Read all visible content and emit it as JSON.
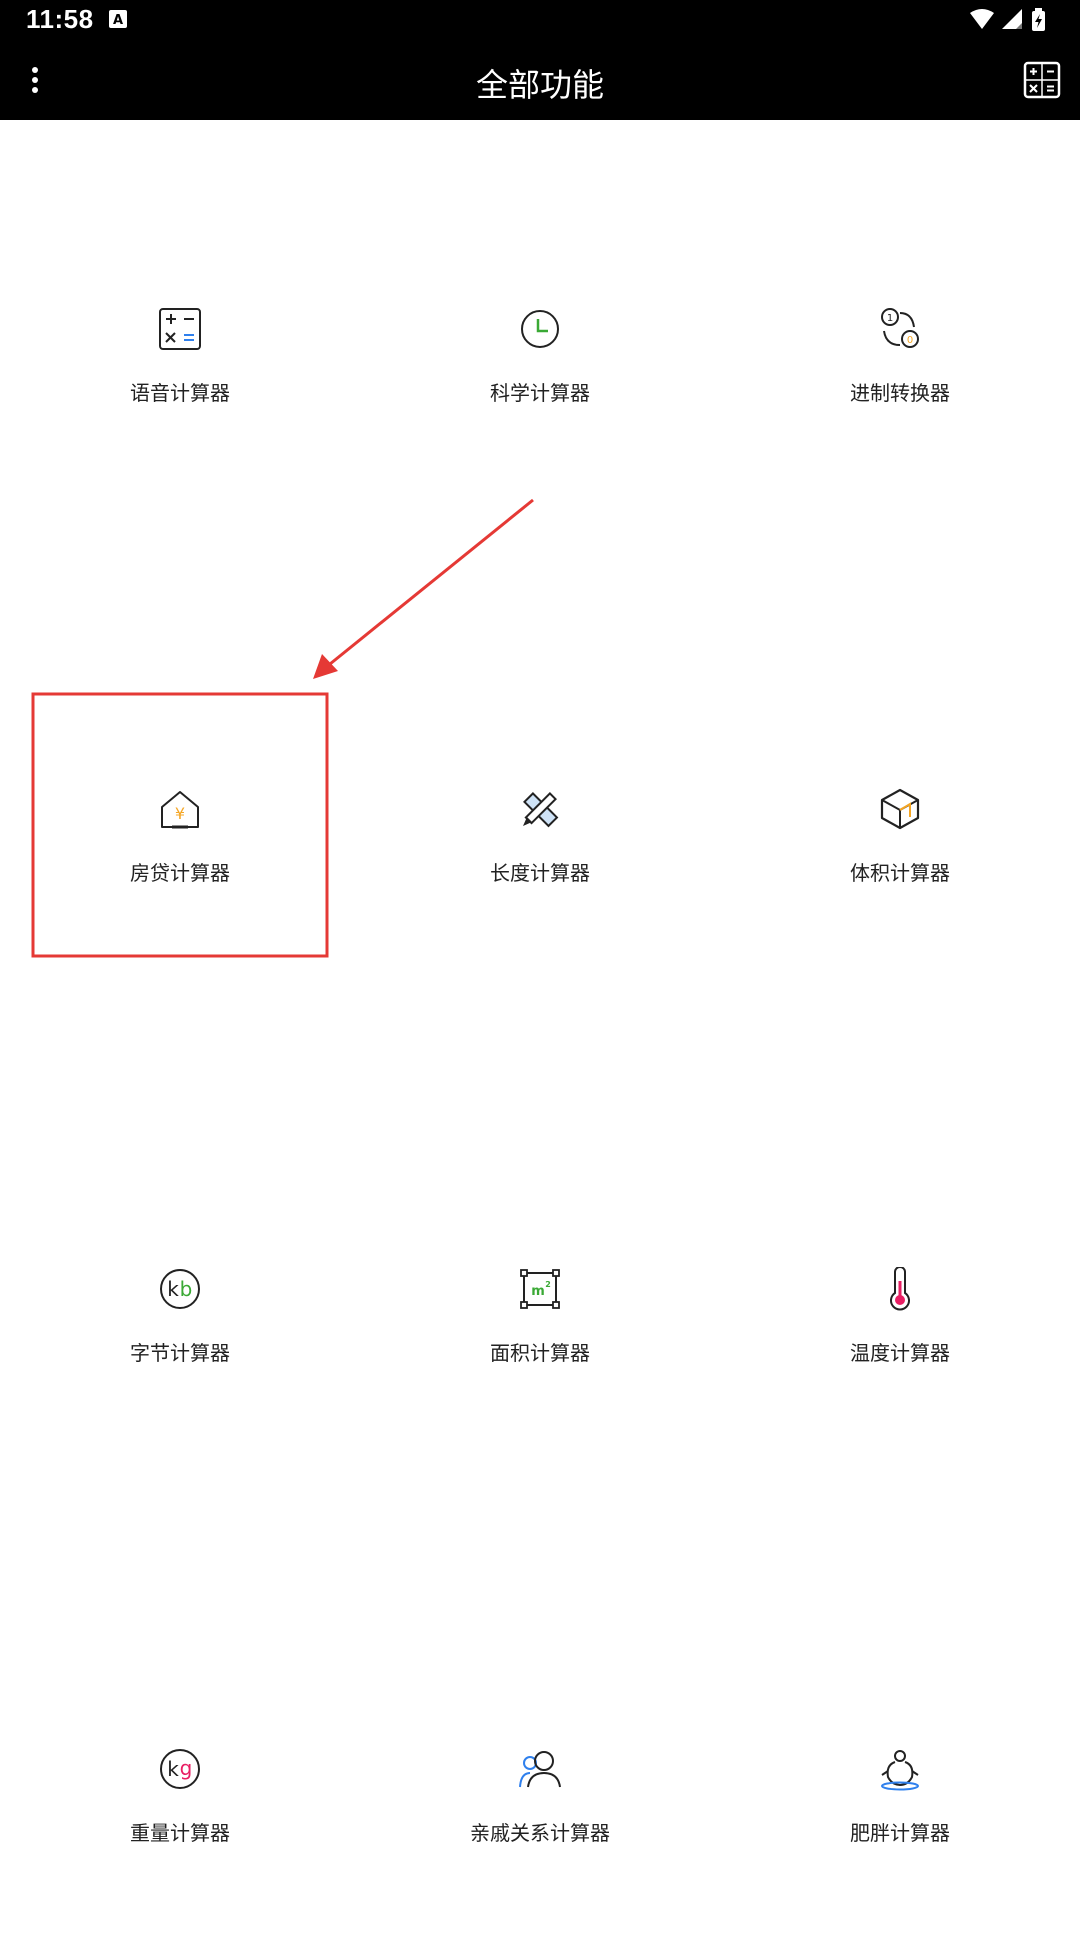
{
  "status_bar": {
    "time": "11:58",
    "icons": [
      "text-notification-icon",
      "wifi-icon",
      "signal-icon",
      "battery-charging-icon"
    ]
  },
  "app_bar": {
    "title": "全部功能",
    "left_icon": "more-vert-icon",
    "right_icon": "calculator-icon"
  },
  "features": [
    {
      "label": "语音计算器",
      "icon": "calculator-icon"
    },
    {
      "label": "科学计算器",
      "icon": "clock-icon"
    },
    {
      "label": "进制转换器",
      "icon": "base-convert-icon"
    },
    {
      "label": "房贷计算器",
      "icon": "house-yuan-icon"
    },
    {
      "label": "长度计算器",
      "icon": "ruler-pencil-icon"
    },
    {
      "label": "体积计算器",
      "icon": "cube-icon"
    },
    {
      "label": "字节计算器",
      "icon": "kb-icon"
    },
    {
      "label": "面积计算器",
      "icon": "area-m2-icon"
    },
    {
      "label": "温度计算器",
      "icon": "thermometer-icon"
    },
    {
      "label": "重量计算器",
      "icon": "kg-icon"
    },
    {
      "label": "亲戚关系计算器",
      "icon": "relatives-icon"
    },
    {
      "label": "肥胖计算器",
      "icon": "body-fat-icon"
    }
  ],
  "colors": {
    "bar_background": "#000000",
    "highlight": "#e53935",
    "accent_green": "#3aa935",
    "accent_orange": "#f5a623",
    "accent_blue": "#2f80ed",
    "accent_pink": "#e91e63"
  }
}
